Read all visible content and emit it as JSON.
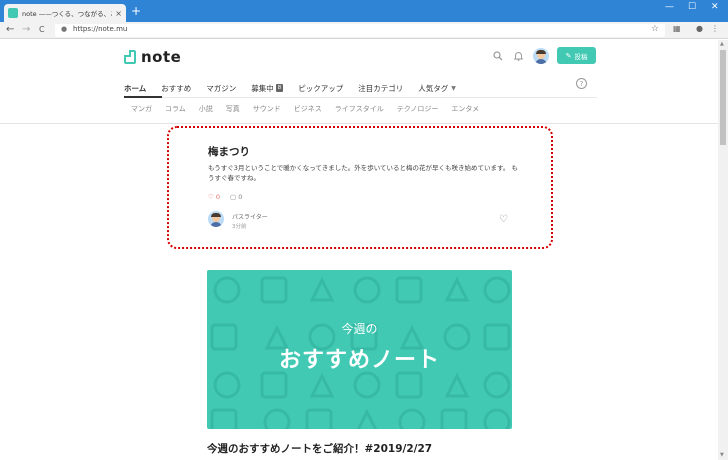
{
  "browser": {
    "tab_title": "note ——つくる、つながる、とどける。",
    "tab_close": "×",
    "new_tab": "+",
    "win_min": "—",
    "win_max": "☐",
    "win_close": "✕",
    "back": "←",
    "forward": "→",
    "reload": "C",
    "url": "https://note.mu"
  },
  "header": {
    "logo_text": "note",
    "post_button": "投稿"
  },
  "menu": {
    "items": [
      {
        "label": "ホーム"
      },
      {
        "label": "おすすめ"
      },
      {
        "label": "マガジン"
      },
      {
        "label": "募集中",
        "badge": "8"
      },
      {
        "label": "ピックアップ"
      },
      {
        "label": "注目カテゴリ"
      },
      {
        "label": "人気タグ"
      }
    ],
    "help": "?"
  },
  "categories": [
    "マンガ",
    "コラム",
    "小説",
    "写真",
    "サウンド",
    "ビジネス",
    "ライフスタイル",
    "テクノロジー",
    "エンタメ"
  ],
  "article": {
    "title": "梅まつり",
    "body": "もうすぐ3月ということで暖かくなってきました。外を歩いていると梅の花が早くも咲き始めています。 もうすぐ春ですね。",
    "likes": "0",
    "comments": "0",
    "author": "パスライター",
    "time": "3分前"
  },
  "banner": {
    "line1": "今週の",
    "line2": "おすすめノート"
  },
  "headline": "今週のおすすめノートをご紹介！#2019/2/27",
  "colors": {
    "accent": "#41c9b4",
    "titlebar": "#2f84d6",
    "highlight_border": "#d20000"
  }
}
